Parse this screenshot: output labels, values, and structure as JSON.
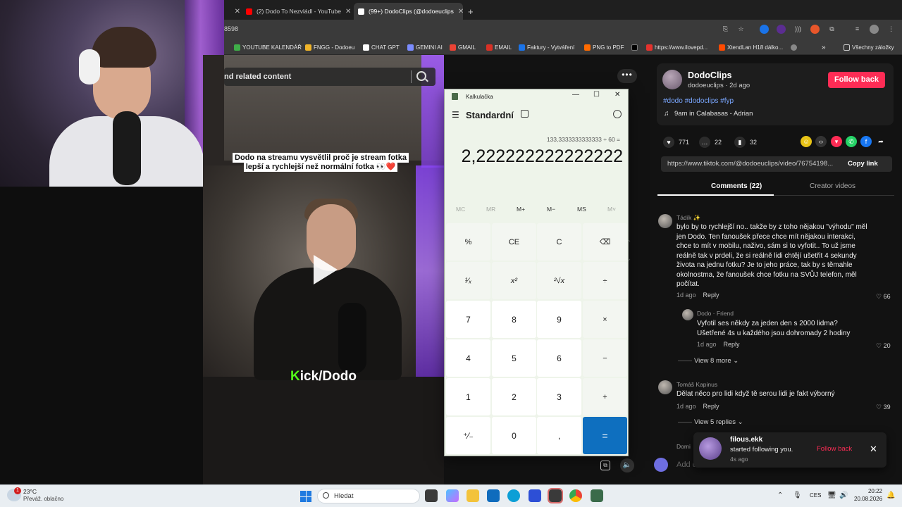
{
  "browser": {
    "tabs": [
      {
        "label": "(2) Dodo To Nezvládl - YouTube",
        "icon": "youtube-icon",
        "color": "#ff0000"
      },
      {
        "label": "(99+) DodoClips (@dodoeuclips",
        "icon": "tiktok-icon",
        "color": "#ffffff",
        "active": true
      }
    ],
    "address": "8598",
    "bookmarks": [
      {
        "label": "YOUTUBE KALENDÁŘ",
        "color": "#3fae49"
      },
      {
        "label": "FNGG - Dodoeu",
        "color": "#f0b429"
      },
      {
        "label": "CHAT GPT",
        "color": "#ffffff"
      },
      {
        "label": "GEMINI AI",
        "color": "#7b8cff"
      },
      {
        "label": "GMAIL",
        "color": "#ea4335"
      },
      {
        "label": "EMAIL",
        "color": "#d93025"
      },
      {
        "label": "Faktury - Vytváření",
        "color": "#1a73e8"
      },
      {
        "label": "PNG to PDF",
        "color": "#ff6b00"
      },
      {
        "label": "",
        "color": "#000000"
      },
      {
        "label": "https://www.ilovepd...",
        "color": "#e5322d"
      },
      {
        "label": "XtendLan H18 dálko...",
        "color": "#ff4a00"
      },
      {
        "label": "",
        "color": "#888888"
      }
    ],
    "bookmarks_more": "»",
    "all_bookmarks": "Všechny záložky"
  },
  "video": {
    "search_placeholder": "nd related content",
    "caption": "Dodo na streamu vysvětlil proč je stream fotka lepší a rychlejší než normální fotka 👀❤️",
    "watermark_k": "K",
    "watermark_rest": "ick/Dodo",
    "more_dots": "•••"
  },
  "post": {
    "author": "DodoClips",
    "handle": "dodoeuclips · 2d ago",
    "follow_back": "Follow back",
    "hashtags": "#dodo #dodoclips #fyp",
    "music": "9am in Calabasas - Adrian",
    "stats": {
      "likes": "771",
      "comments": "22",
      "saves": "32"
    },
    "link": "https://www.tiktok.com/@dodoeuclips/video/76754198...",
    "copy_link": "Copy link",
    "tab_comments": "Comments (22)",
    "tab_creator": "Creator videos"
  },
  "comments": [
    {
      "name": "Tádík ✨",
      "text": "bylo by to rychlejší no.. takže by z toho nějakou \"výhodu\" měl jen Dodo. Ten fanoušek přece chce mít nějakou interakci, chce to mít v mobilu, naživo, sám si to vyfotit.. To už jsme reálně tak v prdeli, že si reálně lidi chtějí ušetřit 4 sekundy života na jednu fotku? Je to jeho práce, tak by s těmahle okolnostma, že fanoušek chce fotku na SVŮJ telefon, měl počítat.",
      "age": "1d ago",
      "reply": "Reply",
      "likes": "66"
    },
    {
      "name": "Dodo · Friend",
      "text": "Vyfotil ses někdy za jeden den s 2000 lidma? Ušetřené 4s u každého jsou dohromady 2 hodiny",
      "age": "1d ago",
      "reply": "Reply",
      "likes": "20"
    },
    {
      "name": "Tomáš Kapinus",
      "text": "Dělat něco pro lidi když tě serou lidi je fakt výborný",
      "age": "1d ago",
      "reply": "Reply",
      "likes": "39"
    },
    {
      "name": "Domi",
      "text": "",
      "age": "",
      "reply": "",
      "likes": ""
    }
  ],
  "view_more": "View 8 more",
  "view_replies": "View 5 replies",
  "add_comment": "Add c",
  "notification": {
    "name": "filous.ekk",
    "text": "started following you.",
    "time": "4s ago",
    "follow_back": "Follow back"
  },
  "calculator": {
    "title": "Kalkulačka",
    "mode": "Standardní",
    "expression": "133,3333333333333 ÷ 60 =",
    "display": "2,222222222222222",
    "memory": [
      "MC",
      "MR",
      "M+",
      "M−",
      "MS",
      "M˅"
    ],
    "keys": [
      [
        "%",
        "CE",
        "C",
        "⌫"
      ],
      [
        "¹⁄ₓ",
        "x²",
        "²√x",
        "÷"
      ],
      [
        "7",
        "8",
        "9",
        "×"
      ],
      [
        "4",
        "5",
        "6",
        "−"
      ],
      [
        "1",
        "2",
        "3",
        "+"
      ],
      [
        "⁺⁄₋",
        "0",
        ",",
        "="
      ]
    ]
  },
  "taskbar": {
    "weather_badge": "1",
    "temp": "23°C",
    "weather": "Převáž. oblačno",
    "search": "Hledat",
    "lang": "CES",
    "time": "20:22",
    "date": "20.08.2026"
  },
  "colors": {
    "tiktok_red": "#fe2c55",
    "kick_green": "#53fc18",
    "calc_equals": "#0e6fbf",
    "hashtag_blue": "#7aa7ff"
  }
}
